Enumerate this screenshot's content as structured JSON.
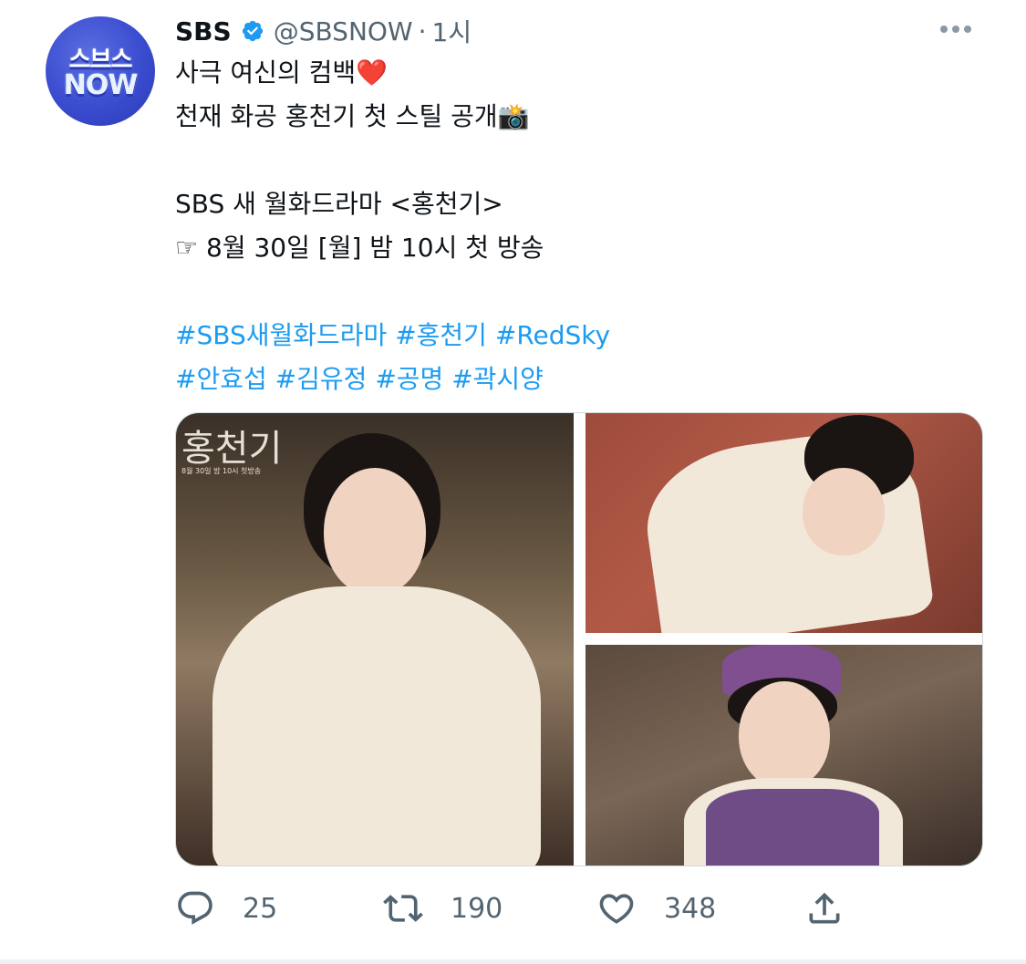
{
  "tweet": {
    "avatar": {
      "line1": "스브스",
      "line2": "NOW"
    },
    "display_name": "SBS",
    "handle": "@SBSNOW",
    "separator": "·",
    "time": "1시",
    "text": {
      "line1": "사극 여신의 컴백",
      "line1_emoji": "❤️",
      "line2": "천재 화공 홍천기 첫 스틸 공개",
      "line2_emoji": "📸",
      "line3": "SBS 새 월화드라마 <홍천기>",
      "line4": "☞ 8월 30일 [월] 밤 10시 첫 방송"
    },
    "hashtags": {
      "row1": [
        "#SBS새월화드라마",
        "#홍천기",
        "#RedSky"
      ],
      "row2": [
        "#안효섭",
        "#김유정",
        "#공명",
        "#곽시양"
      ]
    },
    "media": {
      "photo1_overlay_title": "홍천기",
      "photo1_overlay_sub": "8월 30일 밤 10시 첫방송"
    },
    "counts": {
      "replies": "25",
      "retweets": "190",
      "likes": "348"
    },
    "colors": {
      "accent": "#1d9bf0",
      "muted": "#536471",
      "verified": "#1d9bf0",
      "heart": "#e3243b"
    }
  }
}
